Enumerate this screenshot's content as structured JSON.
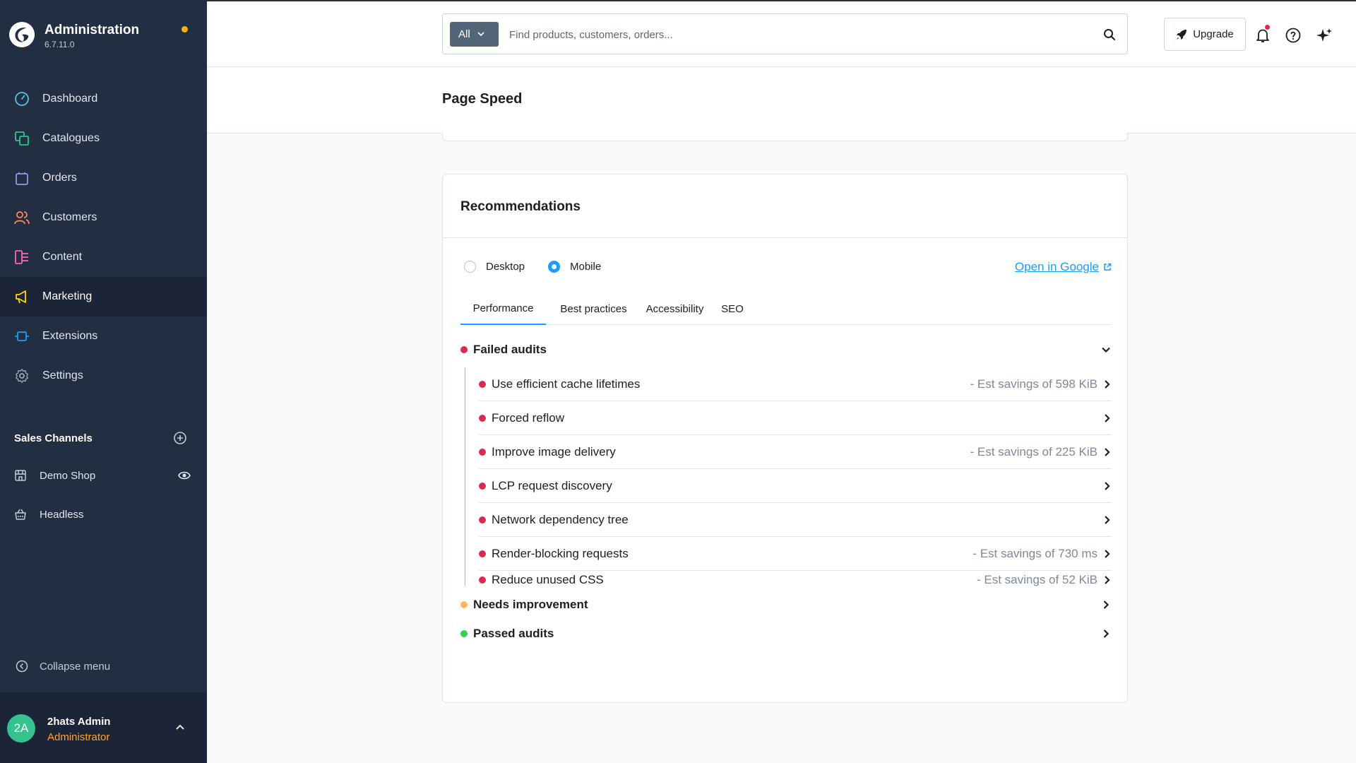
{
  "app": {
    "title": "Administration",
    "version": "6.7.11.0"
  },
  "sidebar": {
    "items": [
      {
        "label": "Dashboard",
        "icon": "dashboard-icon",
        "color": "#4dc7e8"
      },
      {
        "label": "Catalogues",
        "icon": "catalogues-icon",
        "color": "#34c38f"
      },
      {
        "label": "Orders",
        "icon": "orders-icon",
        "color": "#a092f0"
      },
      {
        "label": "Customers",
        "icon": "customers-icon",
        "color": "#f88962"
      },
      {
        "label": "Content",
        "icon": "content-icon",
        "color": "#ff68b4"
      },
      {
        "label": "Marketing",
        "icon": "marketing-icon",
        "color": "#ffd700",
        "active": true
      },
      {
        "label": "Extensions",
        "icon": "extensions-icon",
        "color": "#189eff"
      },
      {
        "label": "Settings",
        "icon": "settings-icon",
        "color": "#9aa8b5"
      }
    ],
    "sales_channels": {
      "title": "Sales Channels",
      "items": [
        {
          "label": "Demo Shop"
        },
        {
          "label": "Headless"
        }
      ]
    },
    "collapse_label": "Collapse menu"
  },
  "user": {
    "initials": "2A",
    "name": "2hats Admin",
    "role": "Administrator"
  },
  "topbar": {
    "filter_label": "All",
    "search_placeholder": "Find products, customers, orders...",
    "upgrade_label": "Upgrade"
  },
  "page": {
    "title": "Page Speed"
  },
  "card": {
    "title": "Recommendations",
    "device_options": [
      {
        "label": "Desktop",
        "selected": false
      },
      {
        "label": "Mobile",
        "selected": true
      }
    ],
    "open_link": "Open in Google",
    "tabs": [
      {
        "label": "Performance",
        "active": true
      },
      {
        "label": "Best practices"
      },
      {
        "label": "Accessibility"
      },
      {
        "label": "SEO"
      }
    ],
    "groups": [
      {
        "label": "Failed audits",
        "status_color": "#de294c",
        "expanded": true
      },
      {
        "label": "Needs improvement",
        "status_color": "#ffb75d",
        "expanded": false
      },
      {
        "label": "Passed audits",
        "status_color": "#37d046",
        "expanded": false
      }
    ],
    "failed_audits": [
      {
        "label": "Use efficient cache lifetimes",
        "savings": "- Est savings of 598 KiB"
      },
      {
        "label": "Forced reflow",
        "savings": ""
      },
      {
        "label": "Improve image delivery",
        "savings": "- Est savings of 225 KiB"
      },
      {
        "label": "LCP request discovery",
        "savings": ""
      },
      {
        "label": "Network dependency tree",
        "savings": ""
      },
      {
        "label": "Render-blocking requests",
        "savings": "- Est savings of 730 ms"
      },
      {
        "label": "Reduce unused CSS",
        "savings": "- Est savings of 52 KiB"
      }
    ]
  }
}
